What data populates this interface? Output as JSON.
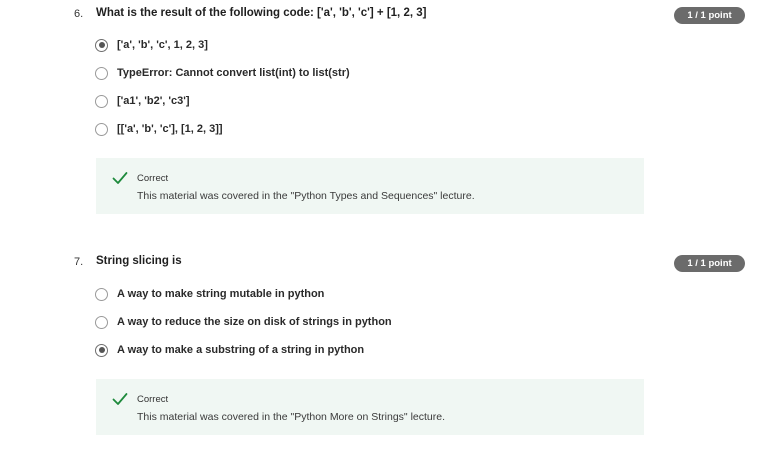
{
  "questions": [
    {
      "number": "6.",
      "text": "What is the result of the following code: ['a', 'b', 'c'] + [1, 2, 3]",
      "points": "1 / 1 point",
      "options": [
        {
          "label": "['a', 'b', 'c', 1, 2, 3]",
          "selected": true
        },
        {
          "label": "TypeError: Cannot convert list(int) to list(str)",
          "selected": false
        },
        {
          "label": "['a1', 'b2', 'c3']",
          "selected": false
        },
        {
          "label": "[['a', 'b', 'c'], [1, 2, 3]]",
          "selected": false
        }
      ],
      "feedback": {
        "status": "Correct",
        "message": "This material was covered in the \"Python Types and Sequences\" lecture.",
        "icon": "checkmark-icon",
        "color": "#1e8a3c"
      }
    },
    {
      "number": "7.",
      "text": "String slicing is",
      "points": "1 / 1 point",
      "options": [
        {
          "label": "A way to make string mutable in python",
          "selected": false
        },
        {
          "label": "A way to reduce the size on disk of strings in python",
          "selected": false
        },
        {
          "label": "A way to make a substring of a string in python",
          "selected": true
        }
      ],
      "feedback": {
        "status": "Correct",
        "message": "This material was covered in the \"Python More on Strings\" lecture.",
        "icon": "checkmark-icon",
        "color": "#1e8a3c"
      }
    }
  ]
}
